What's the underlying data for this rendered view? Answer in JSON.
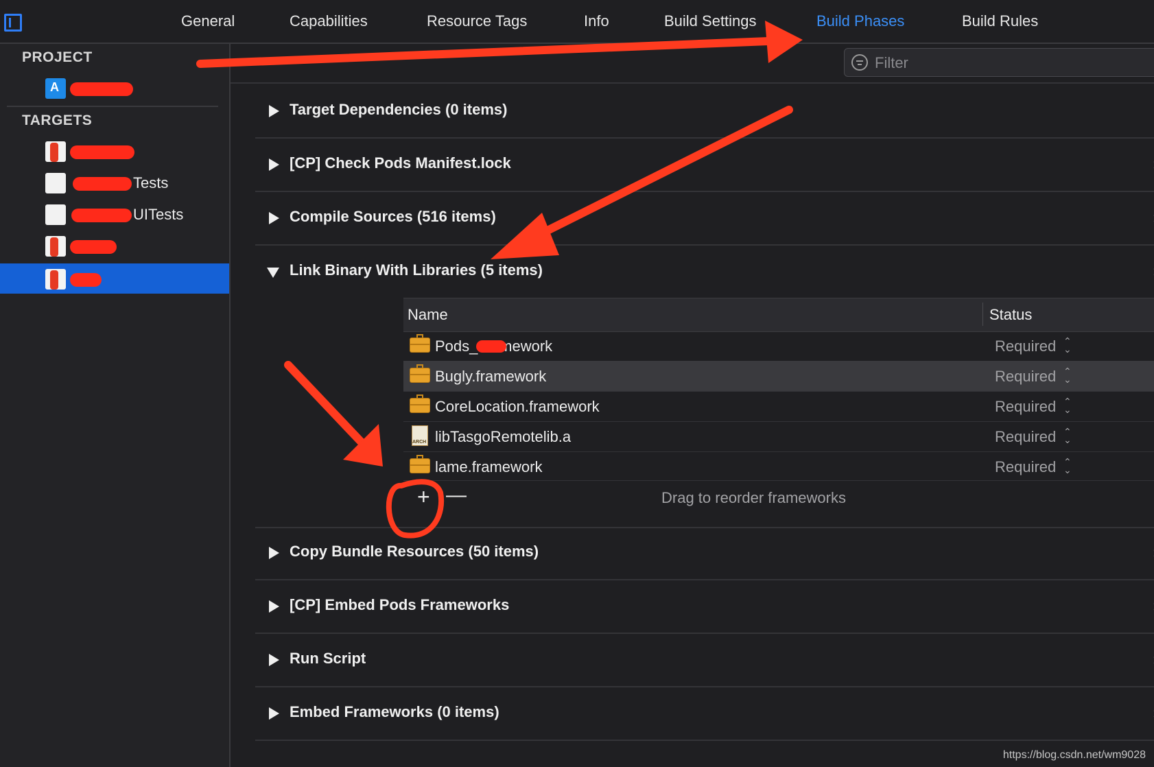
{
  "tabs": [
    {
      "label": "General",
      "active": false
    },
    {
      "label": "Capabilities",
      "active": false
    },
    {
      "label": "Resource Tags",
      "active": false
    },
    {
      "label": "Info",
      "active": false
    },
    {
      "label": "Build Settings",
      "active": false
    },
    {
      "label": "Build Phases",
      "active": true
    },
    {
      "label": "Build Rules",
      "active": false
    }
  ],
  "sidebar": {
    "project_header": "PROJECT",
    "targets_header": "TARGETS",
    "project_item": {
      "label": "",
      "icon": "app-project-icon"
    },
    "targets": [
      {
        "label": "",
        "icon": "app-target-icon",
        "selected": false
      },
      {
        "label": "Tests",
        "icon": "test-bundle-icon",
        "selected": false
      },
      {
        "label": "UITests",
        "icon": "test-bundle-icon",
        "selected": false
      },
      {
        "label": "",
        "icon": "app-target-icon",
        "selected": false
      },
      {
        "label": "",
        "icon": "app-target-icon",
        "selected": true
      }
    ]
  },
  "filter": {
    "placeholder": "Filter",
    "value": ""
  },
  "phases": [
    {
      "title": "Target Dependencies (0 items)",
      "expanded": false
    },
    {
      "title": "[CP] Check Pods Manifest.lock",
      "expanded": false
    },
    {
      "title": "Compile Sources (516 items)",
      "expanded": false
    },
    {
      "title": "Link Binary With Libraries (5 items)",
      "expanded": true
    },
    {
      "title": "Copy Bundle Resources (50 items)",
      "expanded": false
    },
    {
      "title": "[CP] Embed Pods Frameworks",
      "expanded": false
    },
    {
      "title": "Run Script",
      "expanded": false
    },
    {
      "title": "Embed Frameworks (0 items)",
      "expanded": false
    }
  ],
  "link_table": {
    "col_name": "Name",
    "col_status": "Status",
    "rows": [
      {
        "name": "Pods_.framework",
        "status": "Required",
        "icon": "framework-icon",
        "selected": false
      },
      {
        "name": "Bugly.framework",
        "status": "Required",
        "icon": "framework-icon",
        "selected": true
      },
      {
        "name": "CoreLocation.framework",
        "status": "Required",
        "icon": "framework-icon",
        "selected": false
      },
      {
        "name": "libTasgoRemotelib.a",
        "status": "Required",
        "icon": "static-library-icon",
        "selected": false
      },
      {
        "name": "lame.framework",
        "status": "Required",
        "icon": "framework-icon",
        "selected": false
      }
    ],
    "add_label": "+",
    "remove_label": "—",
    "hint": "Drag to reorder frameworks"
  },
  "watermark": "https://blog.csdn.net/wm9028",
  "colors": {
    "accent": "#3b8ff7",
    "selection": "#1561d6",
    "annotation": "#ff3b1f"
  }
}
